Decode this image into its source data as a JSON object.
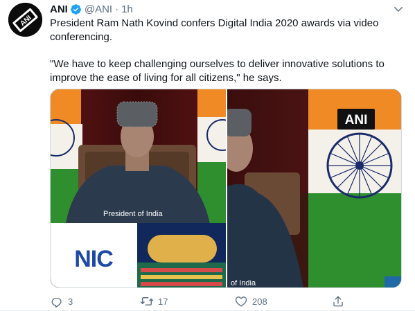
{
  "tweet": {
    "author": {
      "display_name": "ANI",
      "handle": "@ANI",
      "verified": true
    },
    "time": "1h",
    "separator": "·",
    "text_line1": "President Ram Nath Kovind confers Digital India 2020 awards via video conferencing.",
    "text_line2": "\"We have to keep challenging ourselves to deliver innovative solutions to improve the ease of living for all citizens,\" he says.",
    "media": {
      "left_caption": "President of India",
      "left_logo": "NIC",
      "right_watermark": "ANI",
      "right_caption": "of India"
    },
    "actions": {
      "reply_count": "3",
      "retweet_count": "17",
      "like_count": "208"
    }
  },
  "icons": {
    "avatar": "ani-logo",
    "verified": "verified-badge-icon",
    "caret": "chevron-down-icon",
    "reply": "reply-icon",
    "retweet": "retweet-icon",
    "like": "heart-icon",
    "share": "share-icon"
  },
  "colors": {
    "text_primary": "#0f1419",
    "text_secondary": "#5b7083",
    "verified_blue": "#1da1f2",
    "saffron": "#f08a24",
    "india_green": "#2f8f2f",
    "chakra_navy": "#1a2b6b"
  }
}
